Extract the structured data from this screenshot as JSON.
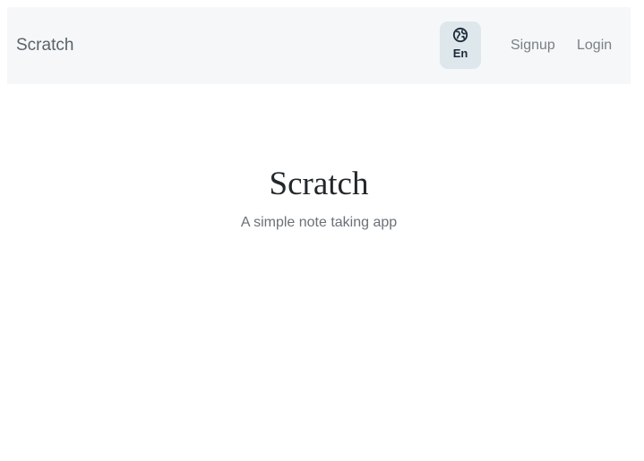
{
  "navbar": {
    "brand": "Scratch",
    "language": {
      "icon": "globe-icon",
      "label": "En"
    },
    "links": {
      "signup": "Signup",
      "login": "Login"
    }
  },
  "hero": {
    "title": "Scratch",
    "subtitle": "A simple note taking app"
  },
  "colors": {
    "navbar_bg": "#f5f7f9",
    "lang_button_bg": "#dde7ec",
    "lang_text": "#1c2a38"
  }
}
